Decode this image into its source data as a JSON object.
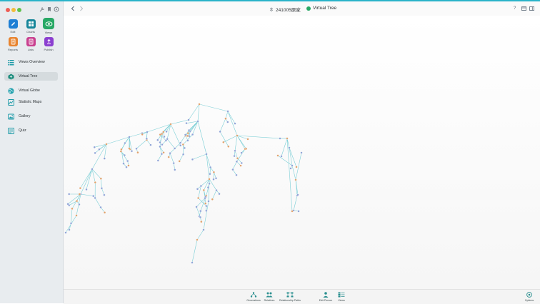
{
  "window": {
    "file_title": "241005原家",
    "view_title": "Virtual Tree"
  },
  "modules": [
    {
      "label": "Edit",
      "icon": "pencil-icon",
      "color": "#1e7fd4"
    },
    {
      "label": "Charts",
      "icon": "charts-icon",
      "color": "#17869a"
    },
    {
      "label": "Views",
      "icon": "eye-icon",
      "color": "#27a865"
    },
    {
      "label": "Reports",
      "icon": "reports-icon",
      "color": "#e8842f"
    },
    {
      "label": "Lists",
      "icon": "lists-icon",
      "color": "#c9408f"
    },
    {
      "label": "Publish",
      "icon": "publish-icon",
      "color": "#8b3fd0"
    }
  ],
  "views_nav": [
    {
      "label": "Views Overview",
      "icon": "grid-icon",
      "selected": false
    },
    {
      "label": "Virtual Tree",
      "icon": "virtual-tree-icon",
      "selected": true
    },
    {
      "label": "Virtual Globe",
      "icon": "globe-icon",
      "selected": false
    },
    {
      "label": "Statistic Maps",
      "icon": "statistic-maps-icon",
      "selected": false
    },
    {
      "label": "Gallery",
      "icon": "gallery-icon",
      "selected": false
    },
    {
      "label": "Quiz",
      "icon": "quiz-icon",
      "selected": false
    }
  ],
  "bottom_tools": [
    {
      "label": "Generations",
      "icon": "generations-icon"
    },
    {
      "label": "Relatives",
      "icon": "relatives-icon"
    },
    {
      "label": "Relationship Paths",
      "icon": "relationship-paths-icon"
    },
    {
      "label": "Edit Person",
      "icon": "edit-person-icon"
    },
    {
      "label": "Views",
      "icon": "views-icon"
    },
    {
      "label": "Options",
      "icon": "options-icon"
    }
  ],
  "colors": {
    "accent": "#2ab3c9",
    "line": "#7ccfd6",
    "male_node": "#8ea2d6",
    "female_node": "#e0a06a"
  }
}
